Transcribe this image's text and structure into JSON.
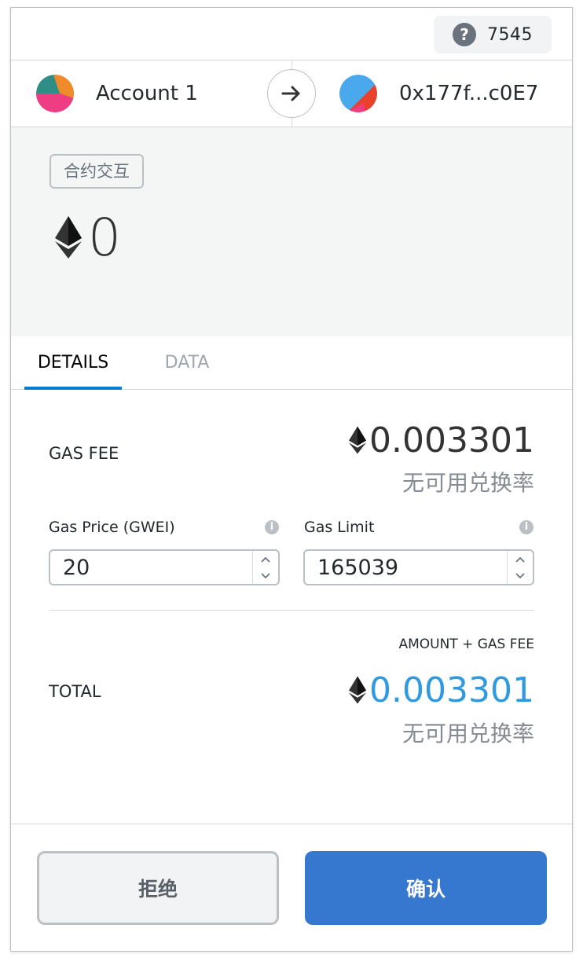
{
  "header": {
    "nonce": "7545",
    "help_icon": "question-circle-icon"
  },
  "accounts": {
    "from": {
      "label": "Account 1",
      "icon": "account-identicon"
    },
    "to": {
      "label": "0x177f...c0E7",
      "icon": "recipient-identicon"
    },
    "arrow_icon": "arrow-right-icon"
  },
  "summary": {
    "method": "合约交互",
    "amount": "0",
    "currency_icon": "eth-diamond-icon"
  },
  "tabs": [
    {
      "label": "DETAILS",
      "active": true
    },
    {
      "label": "DATA",
      "active": false
    }
  ],
  "details": {
    "gas_fee": {
      "label": "GAS FEE",
      "amount": "0.003301",
      "fiat": "无可用兑换率"
    },
    "gas_price": {
      "label": "Gas Price (GWEI)",
      "value": "20"
    },
    "gas_limit": {
      "label": "Gas Limit",
      "value": "165039"
    },
    "total": {
      "sub_label": "AMOUNT + GAS FEE",
      "label": "TOTAL",
      "amount": "0.003301",
      "fiat": "无可用兑换率"
    }
  },
  "footer": {
    "reject": "拒绝",
    "confirm": "确认"
  },
  "colors": {
    "accent": "#037dd6",
    "confirm_bg": "#3677cf",
    "total_amount": "#2f9ae0"
  }
}
